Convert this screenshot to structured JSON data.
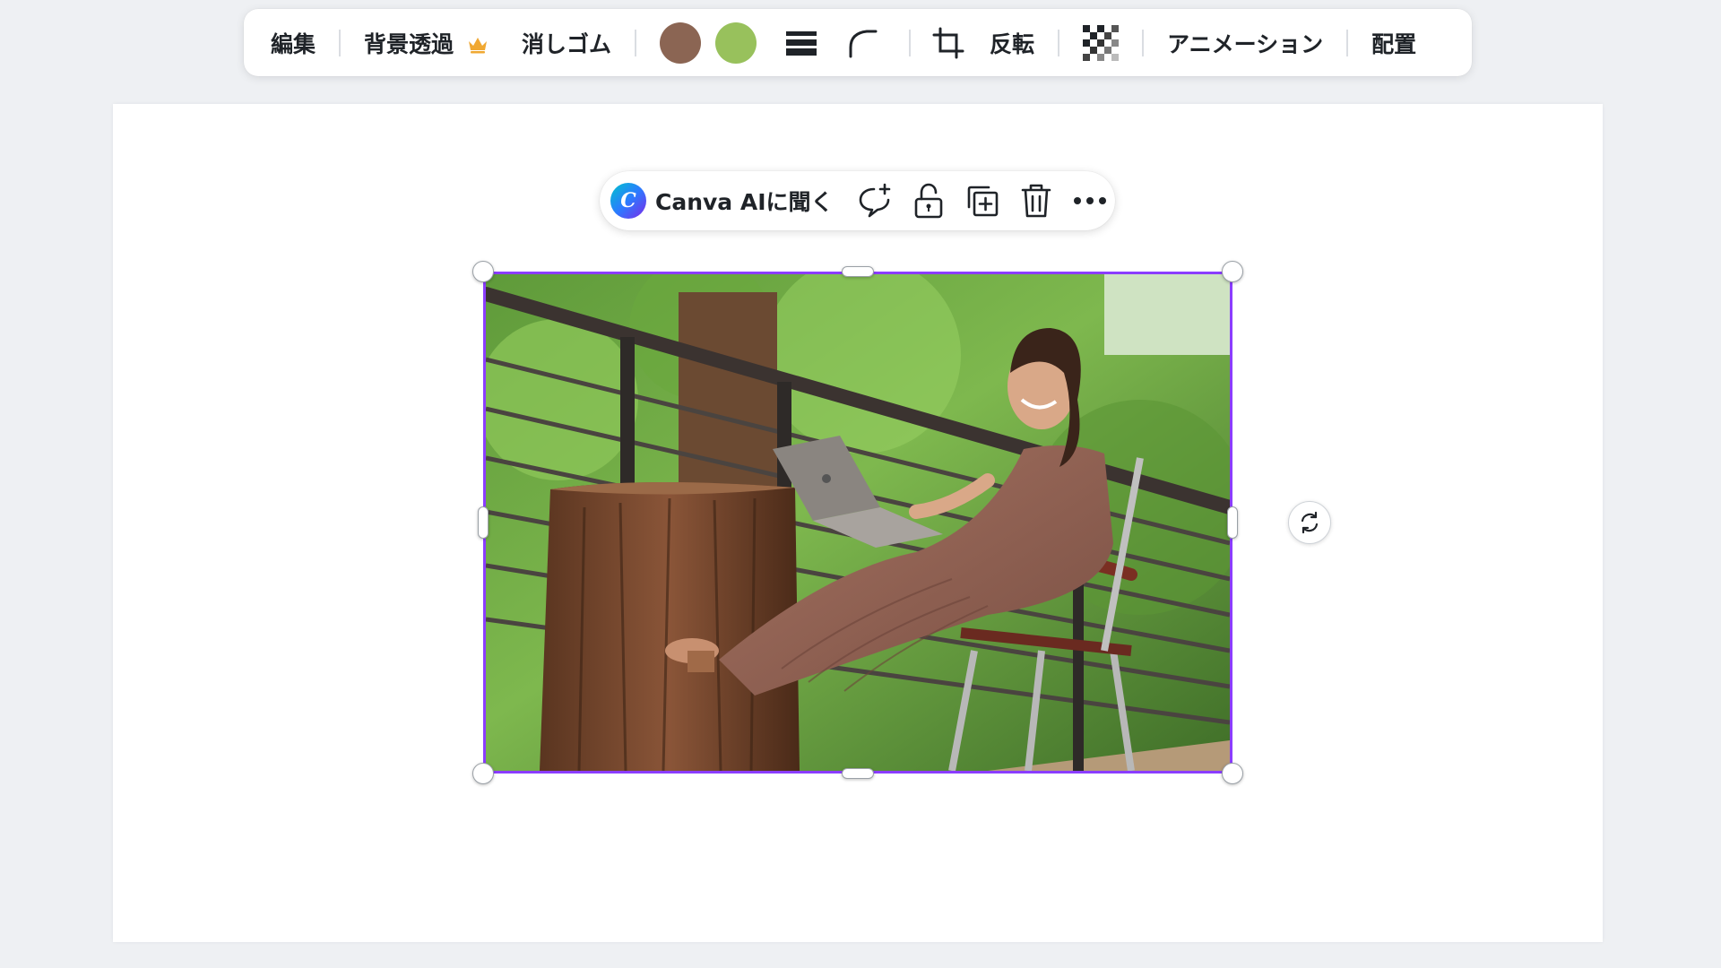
{
  "toolbar": {
    "edit_label": "編集",
    "bg_remove_label": "背景透過",
    "eraser_label": "消しゴム",
    "flip_label": "反転",
    "animation_label": "アニメーション",
    "position_label": "配置",
    "icons": {
      "premium": "crown-icon",
      "line_weight": "line-weight-icon",
      "corner_rounding": "corner-rounding-icon",
      "crop": "crop-icon",
      "transparency": "transparency-checker-icon"
    },
    "color_swatches": [
      "#8b6553",
      "#98c15c"
    ],
    "crown_color": "#f0a832"
  },
  "context_bar": {
    "ai_label": "Canva AIに聞く",
    "icons": {
      "ai": "canva-ai-icon",
      "comment": "add-comment-icon",
      "lock": "lock-icon",
      "duplicate": "duplicate-icon",
      "delete": "trash-icon",
      "more": "more-icon"
    }
  },
  "canvas": {
    "selection_color": "#8b3dff",
    "rotate_icon": "rotate-icon",
    "photo_description_icon": "photo-image"
  }
}
